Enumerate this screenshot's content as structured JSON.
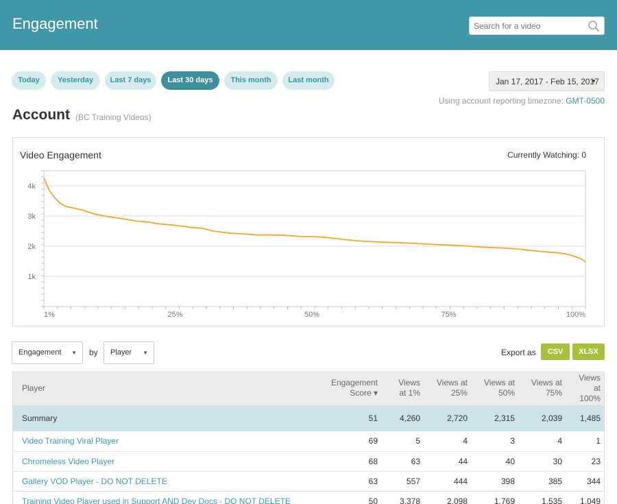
{
  "header": {
    "title": "Engagement",
    "search_placeholder": "Search for a video"
  },
  "date_filters": [
    "Today",
    "Yesterday",
    "Last 7 days",
    "Last 30 days",
    "This month",
    "Last month"
  ],
  "active_filter": "Last 30 days",
  "date_range": "Jan 17, 2017 - Feb 15, 2017",
  "timezone_prefix": "Using account reporting timezone:",
  "timezone": "GMT-0500",
  "account": {
    "title": "Account",
    "subtitle": "(BC Training Videos)"
  },
  "chart_panel": {
    "title": "Video Engagement",
    "currently_watching": "Currently Watching: 0"
  },
  "chart_data": {
    "type": "line",
    "y_tick_labels": [
      "4k",
      "3k",
      "2k",
      "1k"
    ],
    "y_ticks": [
      4000,
      3000,
      2000,
      1000
    ],
    "x_tick_labels": [
      "1%",
      "25%",
      "50%",
      "75%",
      "100%"
    ],
    "x_ticks": [
      1,
      25,
      50,
      75,
      100
    ],
    "xlim": [
      1,
      100
    ],
    "ylim": [
      0,
      4500
    ],
    "series": [
      {
        "color": "#f5a623",
        "x": [
          1,
          2,
          3,
          4,
          5,
          6,
          8,
          10,
          12,
          15,
          18,
          20,
          22,
          25,
          28,
          30,
          32,
          35,
          38,
          40,
          42,
          45,
          48,
          50,
          52,
          55,
          58,
          60,
          62,
          65,
          68,
          70,
          72,
          75,
          78,
          80,
          82,
          85,
          88,
          90,
          92,
          95,
          97,
          98,
          99,
          100
        ],
        "y": [
          4260,
          3850,
          3600,
          3420,
          3320,
          3280,
          3200,
          3080,
          3000,
          2920,
          2830,
          2800,
          2740,
          2690,
          2620,
          2590,
          2500,
          2430,
          2400,
          2370,
          2370,
          2360,
          2320,
          2315,
          2300,
          2240,
          2180,
          2160,
          2140,
          2120,
          2100,
          2080,
          2060,
          2039,
          2010,
          1980,
          1960,
          1940,
          1900,
          1860,
          1820,
          1780,
          1720,
          1660,
          1600,
          1485
        ]
      }
    ],
    "grid": true
  },
  "controls": {
    "metric": "Engagement",
    "by_label": "by",
    "dimension": "Player",
    "export_label": "Export as",
    "export_csv": "CSV",
    "export_xlsx": "XLSX"
  },
  "table": {
    "headers": [
      {
        "line1": "Player",
        "line2": ""
      },
      {
        "line1": "Engagement",
        "line2": "Score ▾"
      },
      {
        "line1": "Views",
        "line2": "at 1%"
      },
      {
        "line1": "Views at",
        "line2": "25%"
      },
      {
        "line1": "Views at",
        "line2": "50%"
      },
      {
        "line1": "Views at",
        "line2": "75%"
      },
      {
        "line1": "Views at",
        "line2": "100%"
      }
    ],
    "summary": [
      "Summary",
      "51",
      "4,260",
      "2,720",
      "2,315",
      "2,039",
      "1,485"
    ],
    "rows": [
      [
        "Video Training Viral Player",
        "69",
        "5",
        "4",
        "3",
        "4",
        "1"
      ],
      [
        "Chromeless Video Player",
        "68",
        "63",
        "44",
        "40",
        "30",
        "23"
      ],
      [
        "Gallery VOD Player - DO NOT DELETE",
        "63",
        "557",
        "444",
        "398",
        "385",
        "344"
      ],
      [
        "Training Video Player used in Support AND Dev Docs - DO NOT DELETE",
        "50",
        "3,378",
        "2,098",
        "1,769",
        "1,535",
        "1,049"
      ]
    ]
  }
}
